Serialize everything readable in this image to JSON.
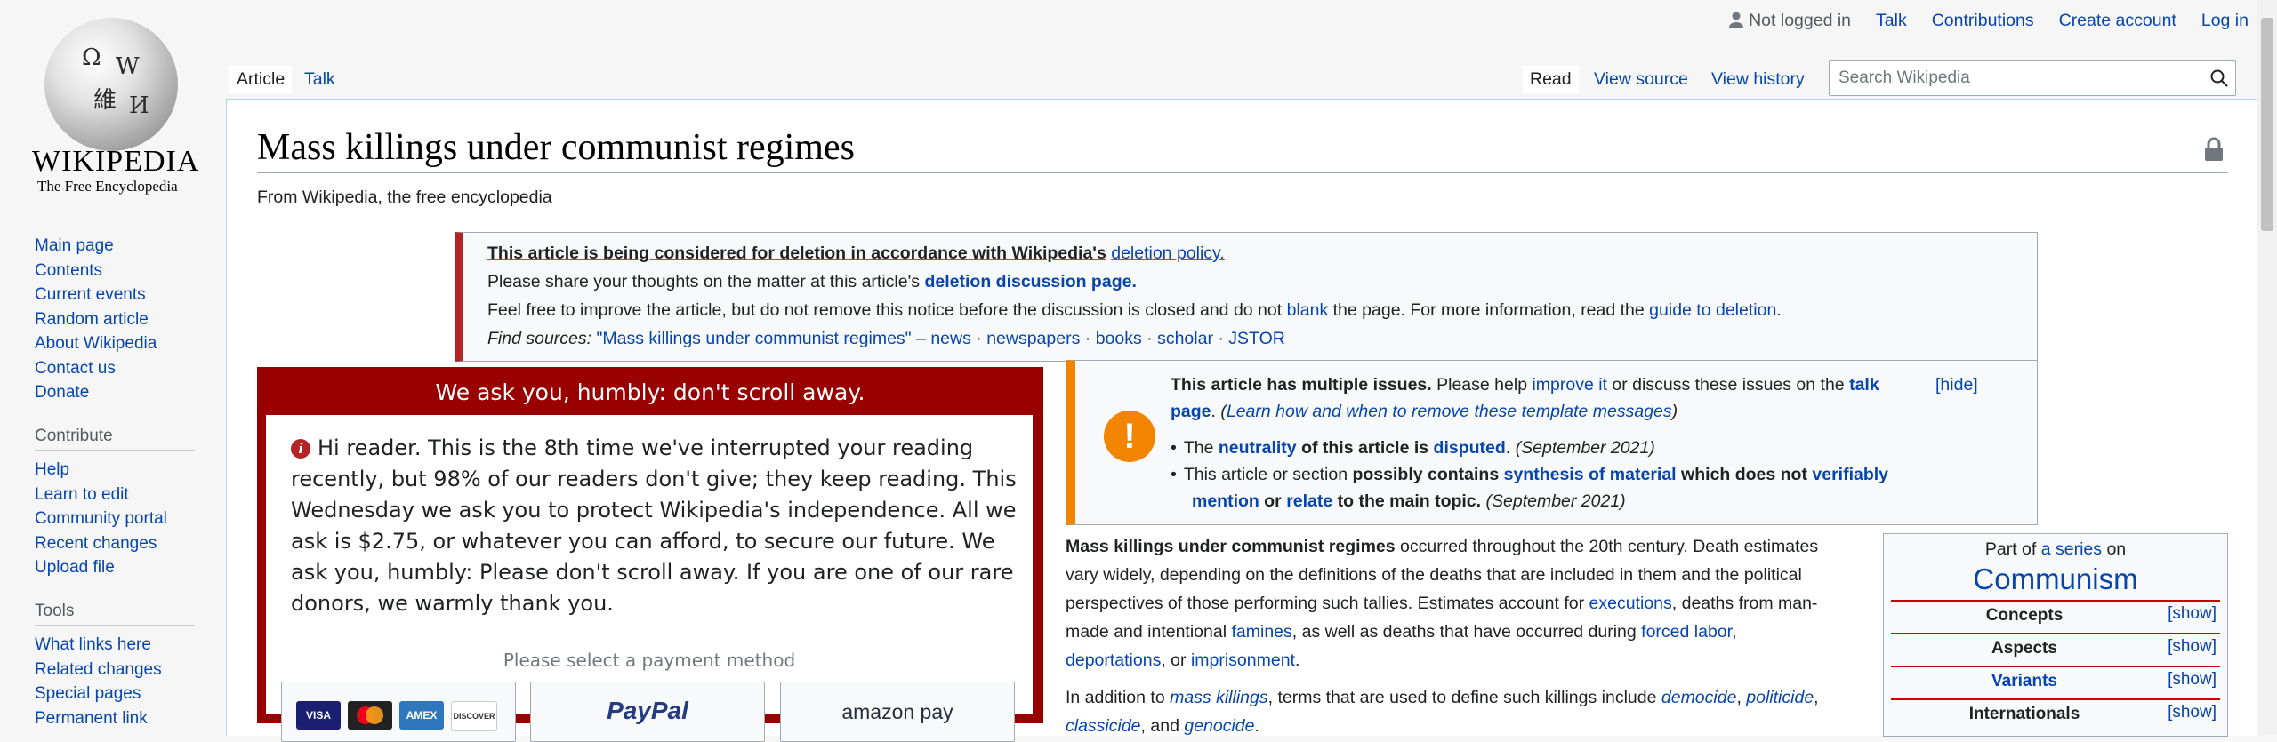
{
  "logo": {
    "wordmark": "WIKIPEDIA",
    "tagline": "The Free Encyclopedia"
  },
  "sidebar": {
    "nav": [
      "Main page",
      "Contents",
      "Current events",
      "Random article",
      "About Wikipedia",
      "Contact us",
      "Donate"
    ],
    "contribute_heading": "Contribute",
    "contribute": [
      "Help",
      "Learn to edit",
      "Community portal",
      "Recent changes",
      "Upload file"
    ],
    "tools_heading": "Tools",
    "tools": [
      "What links here",
      "Related changes",
      "Special pages",
      "Permanent link"
    ]
  },
  "personal": {
    "not_logged_in": "Not logged in",
    "talk": "Talk",
    "contributions": "Contributions",
    "create_account": "Create account",
    "log_in": "Log in"
  },
  "tabs": {
    "article": "Article",
    "talk": "Talk",
    "read": "Read",
    "view_source": "View source",
    "view_history": "View history"
  },
  "search": {
    "placeholder": "Search Wikipedia"
  },
  "page": {
    "title": "Mass killings under communist regimes",
    "sitesub": "From Wikipedia, the free encyclopedia"
  },
  "afd": {
    "line1_bold": "This article is being considered for deletion in accordance with Wikipedia's",
    "line1_link": "deletion policy.",
    "line2_pre": "Please share your thoughts on the matter at this article's",
    "line2_link": "deletion discussion page.",
    "line3_pre": "Feel free to improve the article, but do not remove this notice before the discussion is closed and do not",
    "line3_link1": "blank",
    "line3_mid": "the page. For more information, read the",
    "line3_link2": "guide to deletion",
    "line3_end": ".",
    "find_label": "Find sources:",
    "find_query": "\"Mass killings under communist regimes\"",
    "find_dash": "–",
    "sources": [
      "news",
      "newspapers",
      "books",
      "scholar",
      "JSTOR"
    ]
  },
  "banner": {
    "heading": "We ask you, humbly: don't scroll away.",
    "message": "Hi reader. This is the 8th time we've interrupted your reading recently, but 98% of our readers don't give; they keep reading. This Wednesday we ask you to protect Wikipedia's independence. All we ask is $2.75, or whatever you can afford, to secure our future. We ask you, humbly: Please don't scroll away. If you are one of our rare donors, we warmly thank you.",
    "payment_label": "Please select a payment method",
    "cards": [
      "VISA",
      "MC",
      "AMEX",
      "DISCOVER"
    ],
    "paypal": "PayPal",
    "amazon": "amazon pay"
  },
  "issues": {
    "heading_bold": "This article has multiple issues.",
    "heading_pre": "Please help",
    "improve": "improve it",
    "heading_mid": "or discuss these issues on the",
    "talk_page": "talk page",
    "learn": "Learn how and when to remove these template messages",
    "hide": "[hide]",
    "item1_pre": "The",
    "item1_link1": "neutrality",
    "item1_mid": "of this article is",
    "item1_link2": "disputed",
    "item1_date": "(September 2021)",
    "item2_pre": "This article or section",
    "item2_bold": "possibly contains",
    "item2_link1": "synthesis of material",
    "item2_mid": "which does not",
    "item2_link2": "verifiably mention",
    "item2_or": "or",
    "item2_link3": "relate",
    "item2_end": "to the main topic.",
    "item2_date": "(September 2021)"
  },
  "article": {
    "lead_bold": "Mass killings under communist regimes",
    "l1": "occurred throughout the 20th century. Death estimates",
    "l2": "vary widely, depending on the definitions of the deaths that are included in them and the political",
    "l3": "perspectives of those performing such tallies. Estimates account for",
    "l3_link": "executions",
    "l3_end": ", deaths from man-",
    "l4": "made and intentional",
    "l4_link1": "famines",
    "l4_mid": ", as well as deaths that have occurred during",
    "l4_link2": "forced labor",
    "l4_end": ",",
    "l5_link1": "deportations",
    "l5_mid": ", or",
    "l5_link2": "imprisonment",
    "l5_end": ".",
    "p2": "In addition to",
    "p2_link1": "mass killings",
    "p2_mid": ", terms that are used to define such killings include",
    "p2_link2": "democide",
    "p2_link3": "politicide",
    "p2b_link1": "classicide",
    "p2b_mid": ", and",
    "p2b_link2": "genocide",
    "p2b_end": "."
  },
  "navbox": {
    "part_of": "Part of",
    "series_link": "a series",
    "on": "on",
    "title": "Communism",
    "rows": [
      "Concepts",
      "Aspects",
      "Variants",
      "Internationals"
    ],
    "show": "[show]"
  }
}
